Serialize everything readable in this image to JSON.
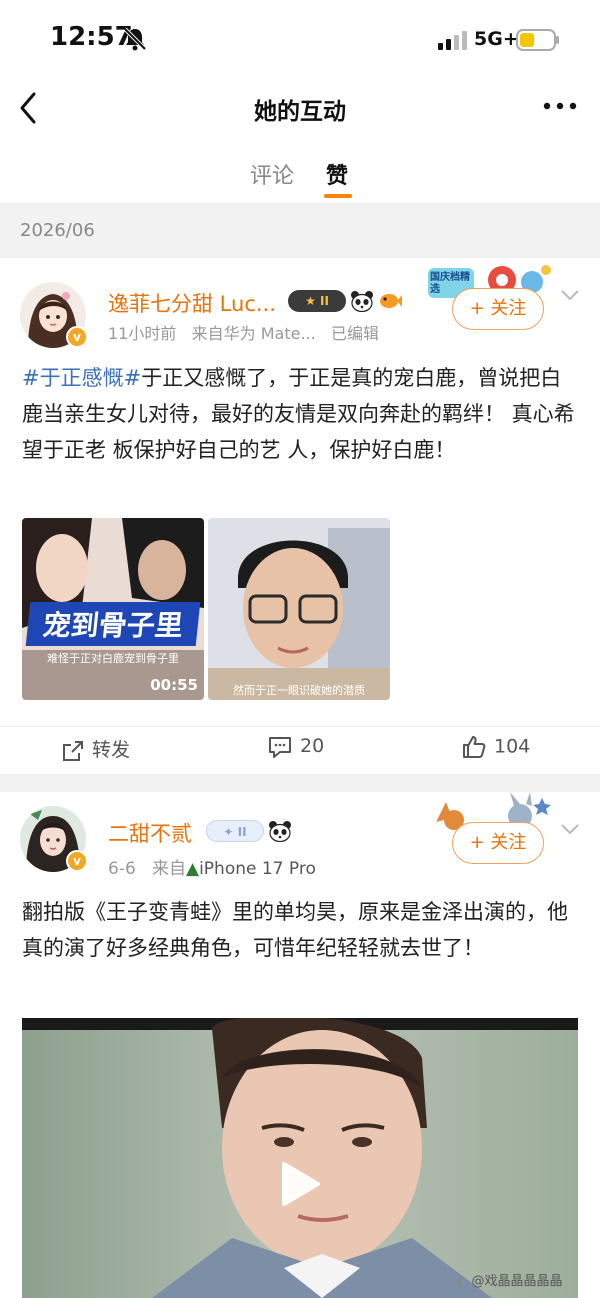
{
  "status": {
    "time": "12:57",
    "network": "5G+"
  },
  "nav": {
    "title": "她的互动"
  },
  "tabs": [
    {
      "label": "评论"
    },
    {
      "label": "赞"
    }
  ],
  "section_date": "2026/06",
  "posts": [
    {
      "username": "逸菲七分甜 Luc...",
      "level": "II",
      "sticker_text": "国庆档精选",
      "time": "11小时前",
      "source": "来自华为 Mate...",
      "edited": "已编辑",
      "follow_label": "+ 关注",
      "hashtag": "#于正感慨#",
      "text": "于正又感慨了，于正是真的宠白鹿，曾说把白鹿当亲生女儿对待，最好的友情是双向奔赴的羁绊！ 真心希望于正老 板保护好自己的艺 人，保护好白鹿！",
      "thumbs": [
        {
          "overlay_title": "宠到骨子里",
          "caption": "难怪于正对白鹿宠到骨子里",
          "duration": "00:55"
        },
        {
          "caption": "然而于正一眼识破她的潜质"
        }
      ],
      "actions": {
        "repost": "转发",
        "comments": "20",
        "likes": "104"
      }
    },
    {
      "username": "二甜不贰",
      "level": "II",
      "time": "6-6",
      "source_prefix": "来自",
      "source": "iPhone 17 Pro",
      "follow_label": "+ 关注",
      "text": "翻拍版《王子变青蛙》里的单均昊，原来是金泽出演的，他真的演了好多经典角色，可惜年纪轻轻就去世了！"
    }
  ],
  "watermark": "@戏晶晶晶晶晶",
  "colors": {
    "accent": "#ff8200",
    "username": "#e8730a",
    "hashtag": "#3b6fb6"
  }
}
